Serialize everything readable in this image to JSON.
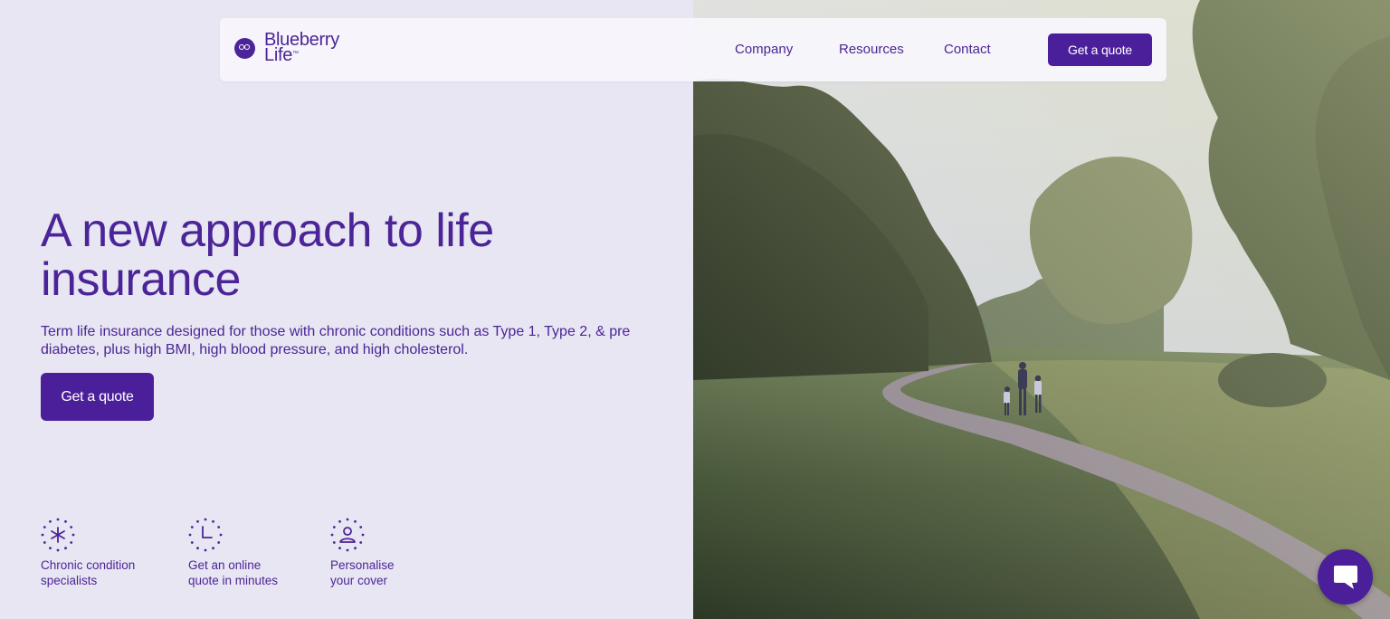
{
  "brand": {
    "line1": "Blueberry",
    "line2": "Life",
    "tm": "™"
  },
  "nav": {
    "links": [
      "Company",
      "Resources",
      "Contact"
    ],
    "cta": "Get a quote"
  },
  "hero": {
    "title_line1": "A new approach to life",
    "title_line2": "insurance",
    "subtitle_line1": "Term life insurance designed for those with chronic conditions such as Type 1, Type 2, & pre",
    "subtitle_line2": "diabetes, plus high BMI, high blood pressure, and high cholesterol.",
    "cta": "Get a quote"
  },
  "features": [
    {
      "icon": "asterisk-dotted-circle-icon",
      "line1": "Chronic condition",
      "line2": "specialists"
    },
    {
      "icon": "clock-dotted-circle-icon",
      "line1": "Get an online",
      "line2": "quote in minutes"
    },
    {
      "icon": "person-dotted-circle-icon",
      "line1": "Personalise",
      "line2": "your cover"
    }
  ],
  "chat": {
    "icon": "chat-bubble-icon"
  },
  "colors": {
    "brand": "#4b1f9a",
    "text": "#4b2597",
    "background": "#e8e6f2"
  }
}
